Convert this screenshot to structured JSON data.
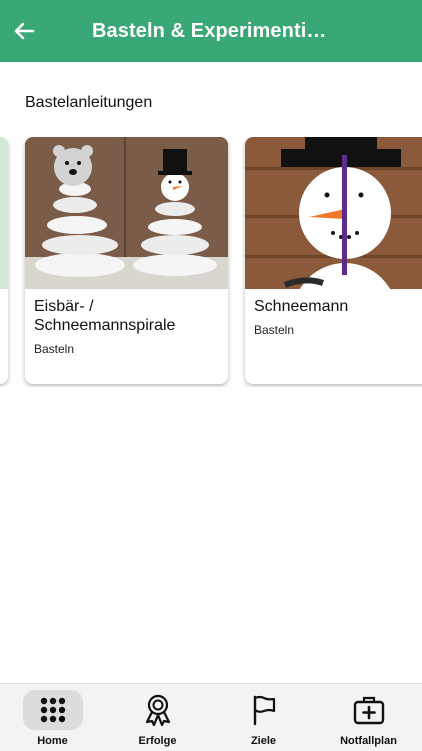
{
  "header": {
    "title": "Basteln & Experimenti…"
  },
  "section": {
    "heading": "Bastelanleitungen"
  },
  "cards": [
    {
      "title": "Eisbär- / Schneemannspirale",
      "category": "Basteln"
    },
    {
      "title": "Schneemann",
      "category": "Basteln"
    }
  ],
  "tabs": [
    {
      "label": "Home",
      "icon": "grid-icon",
      "active": true
    },
    {
      "label": "Erfolge",
      "icon": "award-icon"
    },
    {
      "label": "Ziele",
      "icon": "flag-icon"
    },
    {
      "label": "Notfallplan",
      "icon": "first-aid-kit-icon"
    }
  ],
  "colors": {
    "accent": "#3aa876",
    "tabbar_bg": "#f3f3f3"
  }
}
